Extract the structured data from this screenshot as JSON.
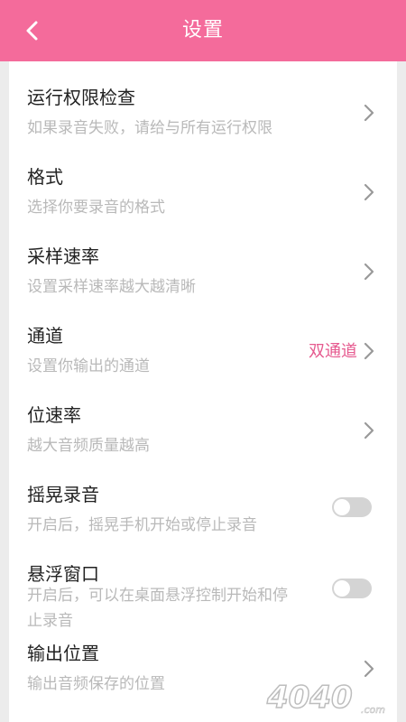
{
  "header": {
    "title": "设置",
    "back_icon": "chevron-left-icon"
  },
  "settings": [
    {
      "title": "运行权限检查",
      "subtitle": "如果录音失败，请给与所有运行权限",
      "control": "chevron"
    },
    {
      "title": "格式",
      "subtitle": "选择你要录音的格式",
      "control": "chevron"
    },
    {
      "title": "采样速率",
      "subtitle": "设置采样速率越大越清晰",
      "control": "chevron"
    },
    {
      "title": "通道",
      "subtitle": "设置你输出的通道",
      "control": "chevron",
      "value": "双通道"
    },
    {
      "title": "位速率",
      "subtitle": "越大音频质量越高",
      "control": "chevron"
    },
    {
      "title": "摇晃录音",
      "subtitle": "开启后，摇晃手机开始或停止录音",
      "control": "toggle",
      "toggle_on": false
    },
    {
      "title": "悬浮窗口",
      "subtitle": "开启后，可以在桌面悬浮控制开始和停止录音",
      "control": "toggle",
      "toggle_on": false
    },
    {
      "title": "输出位置",
      "subtitle": "输出音频保存的位置",
      "control": "chevron"
    }
  ],
  "watermark": {
    "text": "4040",
    "suffix": ".com"
  },
  "colors": {
    "accent": "#f46b9b",
    "value_text": "#e65a8f"
  }
}
